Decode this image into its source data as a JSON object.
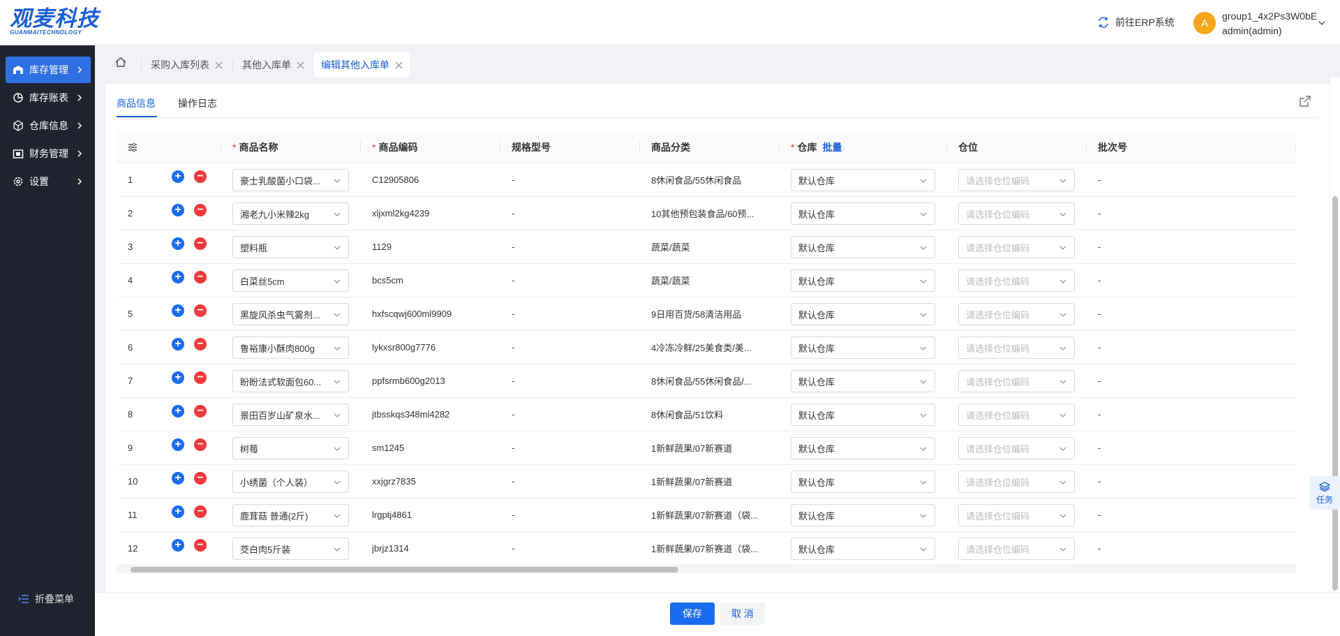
{
  "header": {
    "logo_main": "观麦科技",
    "logo_sub": "GUANMAITECHNOLOGY",
    "erp_link": "前往ERP系统",
    "avatar_letter": "A",
    "user_group": "group1_4x2Ps3W0bE",
    "user_name": "admin(admin)"
  },
  "sidebar": {
    "items": [
      {
        "label": "库存管理",
        "icon": "warehouse-icon"
      },
      {
        "label": "库存账表",
        "icon": "pie-chart-icon"
      },
      {
        "label": "仓库信息",
        "icon": "cube-icon"
      },
      {
        "label": "财务管理",
        "icon": "wallet-icon"
      },
      {
        "label": "设置",
        "icon": "gear-icon"
      }
    ],
    "collapse_label": "折叠菜单"
  },
  "tabs": [
    {
      "label": "采购入库列表"
    },
    {
      "label": "其他入库单"
    },
    {
      "label": "编辑其他入库单"
    }
  ],
  "subtabs": {
    "info": "商品信息",
    "log": "操作日志"
  },
  "columns": {
    "name": "商品名称",
    "code": "商品编码",
    "spec": "规格型号",
    "category": "商品分类",
    "warehouse": "仓库",
    "batch_action": "批量",
    "location": "仓位",
    "batch_no": "批次号"
  },
  "location_placeholder": "请选择仓位编码",
  "rows": [
    {
      "no": "1",
      "name": "豪士乳酸菌小口袋...",
      "code": "C12905806",
      "spec": "-",
      "category": "8休闲食品/55休闲食品",
      "warehouse": "默认仓库",
      "batch": "-"
    },
    {
      "no": "2",
      "name": "湘老九小米辣2kg",
      "code": "xljxml2kg4239",
      "spec": "-",
      "category": "10其他预包装食品/60预...",
      "warehouse": "默认仓库",
      "batch": "-"
    },
    {
      "no": "3",
      "name": "塑料瓶",
      "code": "1129",
      "spec": "-",
      "category": "蔬菜/蔬菜",
      "warehouse": "默认仓库",
      "batch": "-"
    },
    {
      "no": "4",
      "name": "白菜丝5cm",
      "code": "bcs5cm",
      "spec": "-",
      "category": "蔬菜/蔬菜",
      "warehouse": "默认仓库",
      "batch": "-"
    },
    {
      "no": "5",
      "name": "黑旋风杀虫气雾剂...",
      "code": "hxfscqwj600ml9909",
      "spec": "-",
      "category": "9日用百货/58清洁用品",
      "warehouse": "默认仓库",
      "batch": "-"
    },
    {
      "no": "6",
      "name": "鲁裕康小酥肉800g",
      "code": "lykxsr800g7776",
      "spec": "-",
      "category": "4冷冻冷鲜/25美食类/美...",
      "warehouse": "默认仓库",
      "batch": "-"
    },
    {
      "no": "7",
      "name": "盼盼法式软面包60...",
      "code": "ppfsrmb600g2013",
      "spec": "-",
      "category": "8休闲食品/55休闲食品/...",
      "warehouse": "默认仓库",
      "batch": "-"
    },
    {
      "no": "8",
      "name": "景田百岁山矿泉水...",
      "code": "jtbsskqs348ml4282",
      "spec": "-",
      "category": "8休闲食品/51饮料",
      "warehouse": "默认仓库",
      "batch": "-"
    },
    {
      "no": "9",
      "name": "树莓",
      "code": "sm1245",
      "spec": "-",
      "category": "1新鲜蔬果/07新赛道",
      "warehouse": "默认仓库",
      "batch": "-"
    },
    {
      "no": "10",
      "name": "小绣菌（个人装）",
      "code": "xxjgrz7835",
      "spec": "-",
      "category": "1新鲜蔬果/07新赛道",
      "warehouse": "默认仓库",
      "batch": "-"
    },
    {
      "no": "11",
      "name": "鹿茸菇 普通(2斤)",
      "code": "lrgptj4861",
      "spec": "-",
      "category": "1新鲜蔬果/07新赛道（袋...",
      "warehouse": "默认仓库",
      "batch": "-"
    },
    {
      "no": "12",
      "name": "茭白肉5斤装",
      "code": "jbrjz1314",
      "spec": "-",
      "category": "1新鲜蔬果/07新赛道（袋...",
      "warehouse": "默认仓库",
      "batch": "-"
    }
  ],
  "task_label": "任务",
  "footer": {
    "save": "保存",
    "cancel": "取 消"
  },
  "colors": {
    "primary": "#1a6cf0",
    "danger": "#ee3a3a",
    "sidebar": "#1f2430",
    "avatar": "#f7a61c"
  }
}
